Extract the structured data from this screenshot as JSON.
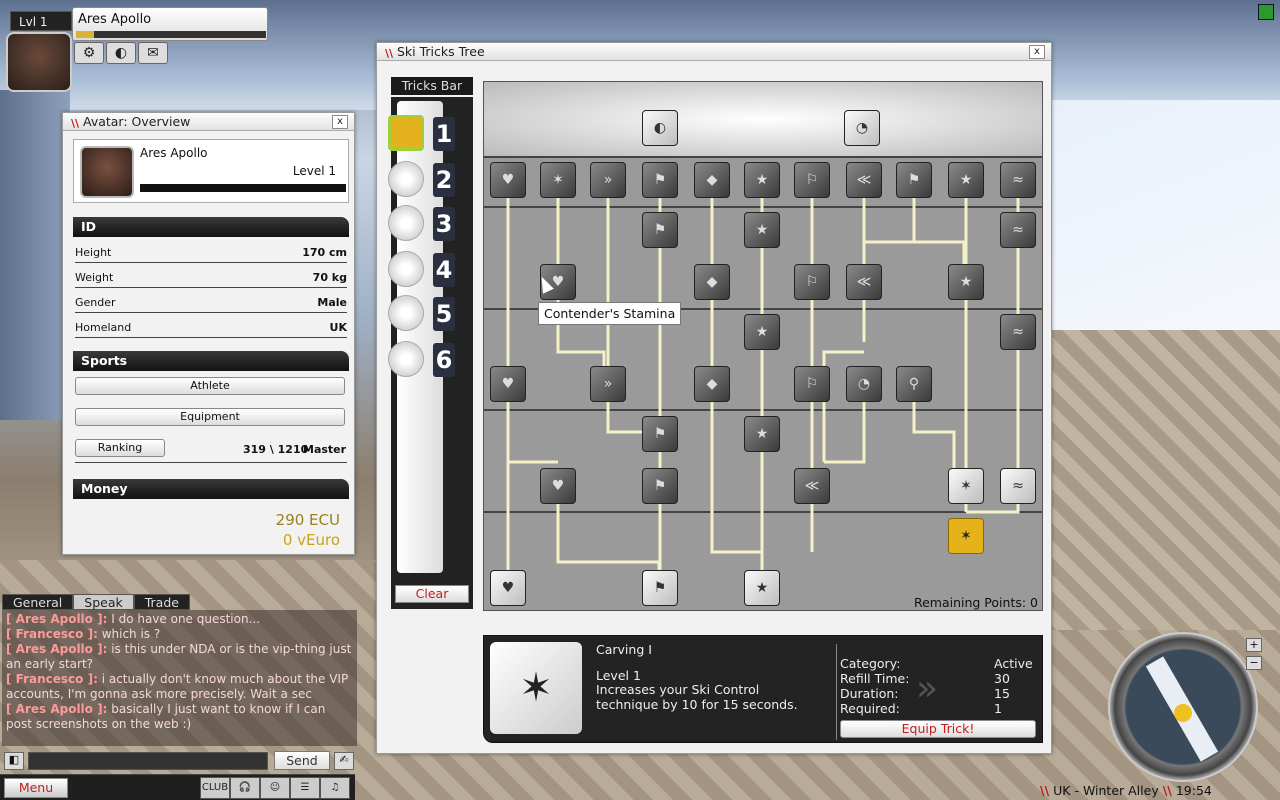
{
  "player": {
    "level_label": "Lvl 1",
    "name": "Ares Apollo"
  },
  "overview": {
    "title": "Avatar: Overview",
    "close": "x",
    "name": "Ares Apollo",
    "level": "Level 1",
    "id_header": "ID",
    "stats": [
      {
        "label": "Height",
        "value": "170 cm"
      },
      {
        "label": "Weight",
        "value": "70 kg"
      },
      {
        "label": "Gender",
        "value": "Male"
      },
      {
        "label": "Homeland",
        "value": "UK"
      }
    ],
    "sports_header": "Sports",
    "athlete_btn": "Athlete",
    "equipment_btn": "Equipment",
    "ranking_btn": "Ranking",
    "ranking_value": "319 \\ 1210",
    "ranking_rank": "Master",
    "money_header": "Money",
    "ecu": "290 ECU",
    "veuro": "0 vEuro"
  },
  "chat": {
    "tabs": [
      "General",
      "Speak",
      "Trade"
    ],
    "active_tab": "Speak",
    "lines": [
      {
        "who": "[ Ares Apollo ]:",
        "text": "I do have one question..."
      },
      {
        "who": "[ Francesco ]:",
        "text": "which is ?"
      },
      {
        "who": "[ Ares Apollo ]:",
        "text": "is this under NDA or is the vip-thing just an early start?"
      },
      {
        "who": "[ Francesco ]:",
        "text": "i actually don't know much about the VIP accounts, I'm gonna ask more precisely. Wait a sec"
      },
      {
        "who": "[ Ares Apollo ]:",
        "text": "basically I just want to know if I can post screenshots on the web :)"
      }
    ],
    "send": "Send"
  },
  "bottom_bar": {
    "menu": "Menu",
    "icons": [
      "club-icon",
      "headphones-icon",
      "smiley-icon",
      "list-icon",
      "music-icon"
    ],
    "club_label": "CLUB"
  },
  "ski_tree": {
    "title": "Ski Tricks Tree",
    "close": "x",
    "tricks_bar_title": "Tricks Bar",
    "slots": [
      "1",
      "2",
      "3",
      "4",
      "5",
      "6"
    ],
    "clear": "Clear",
    "tooltip": "Contender's Stamina",
    "remaining_label": "Remaining Points:",
    "remaining_value": "0",
    "selected": {
      "name": "Carving I",
      "level": "Level 1",
      "description": "Increases your Ski Control technique by 10 for 15 seconds.",
      "fields": [
        {
          "label": "Category:",
          "value": "Active"
        },
        {
          "label": "Refill Time:",
          "value": "30"
        },
        {
          "label": "Duration:",
          "value": "15"
        },
        {
          "label": "Required:",
          "value": "1"
        }
      ],
      "equip": "Equip Trick!"
    }
  },
  "zone": {
    "name": "UK - Winter Alley",
    "time": "19:54"
  },
  "colors": {
    "accent_red": "#c01818",
    "gold": "#e6b21a",
    "money": "#c9a21a"
  }
}
